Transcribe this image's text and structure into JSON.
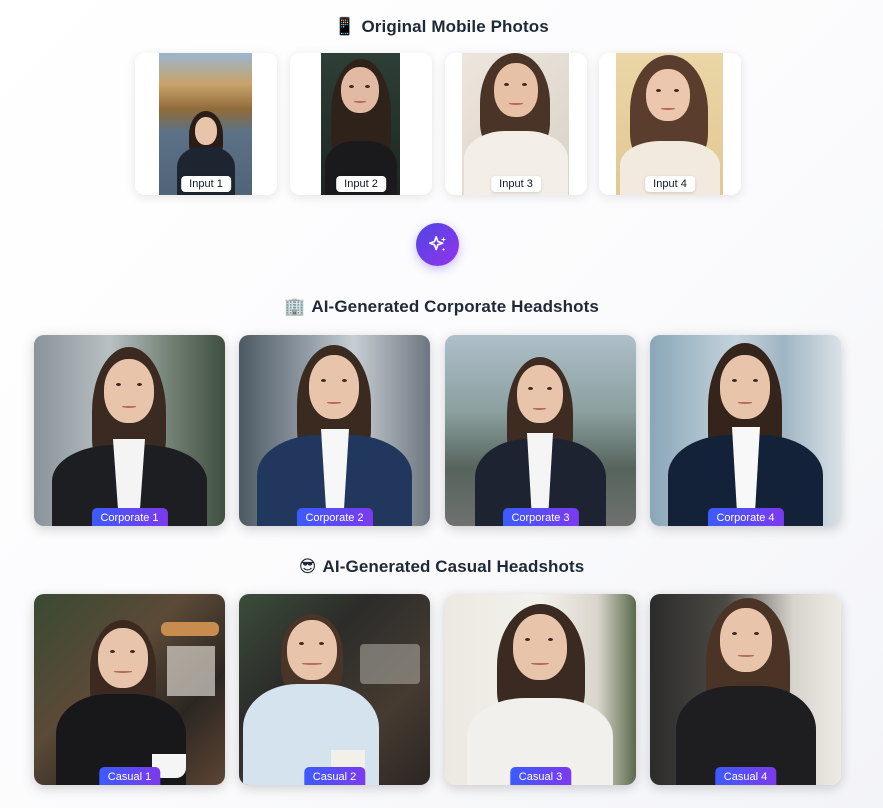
{
  "sections": {
    "original": {
      "emoji": "📱",
      "title": "Original Mobile Photos"
    },
    "corporate": {
      "emoji": "🏢",
      "title": "AI-Generated Corporate Headshots"
    },
    "casual": {
      "emoji": "😎",
      "title": "AI-Generated Casual Headshots"
    }
  },
  "inputs": [
    {
      "label": "Input 1"
    },
    {
      "label": "Input 2"
    },
    {
      "label": "Input 3"
    },
    {
      "label": "Input 4"
    }
  ],
  "action": {
    "icon": "sparkles-icon"
  },
  "corporate": [
    {
      "label": "Corporate 1"
    },
    {
      "label": "Corporate 2"
    },
    {
      "label": "Corporate 3"
    },
    {
      "label": "Corporate 4"
    }
  ],
  "casual": [
    {
      "label": "Casual 1"
    },
    {
      "label": "Casual 2"
    },
    {
      "label": "Casual 3"
    },
    {
      "label": "Casual 4"
    }
  ],
  "colors": {
    "badge_gradient_start": "#3b5bfd",
    "badge_gradient_end": "#7c3aed",
    "button_gradient_start": "#4f46e5",
    "button_gradient_end": "#9333ea"
  }
}
